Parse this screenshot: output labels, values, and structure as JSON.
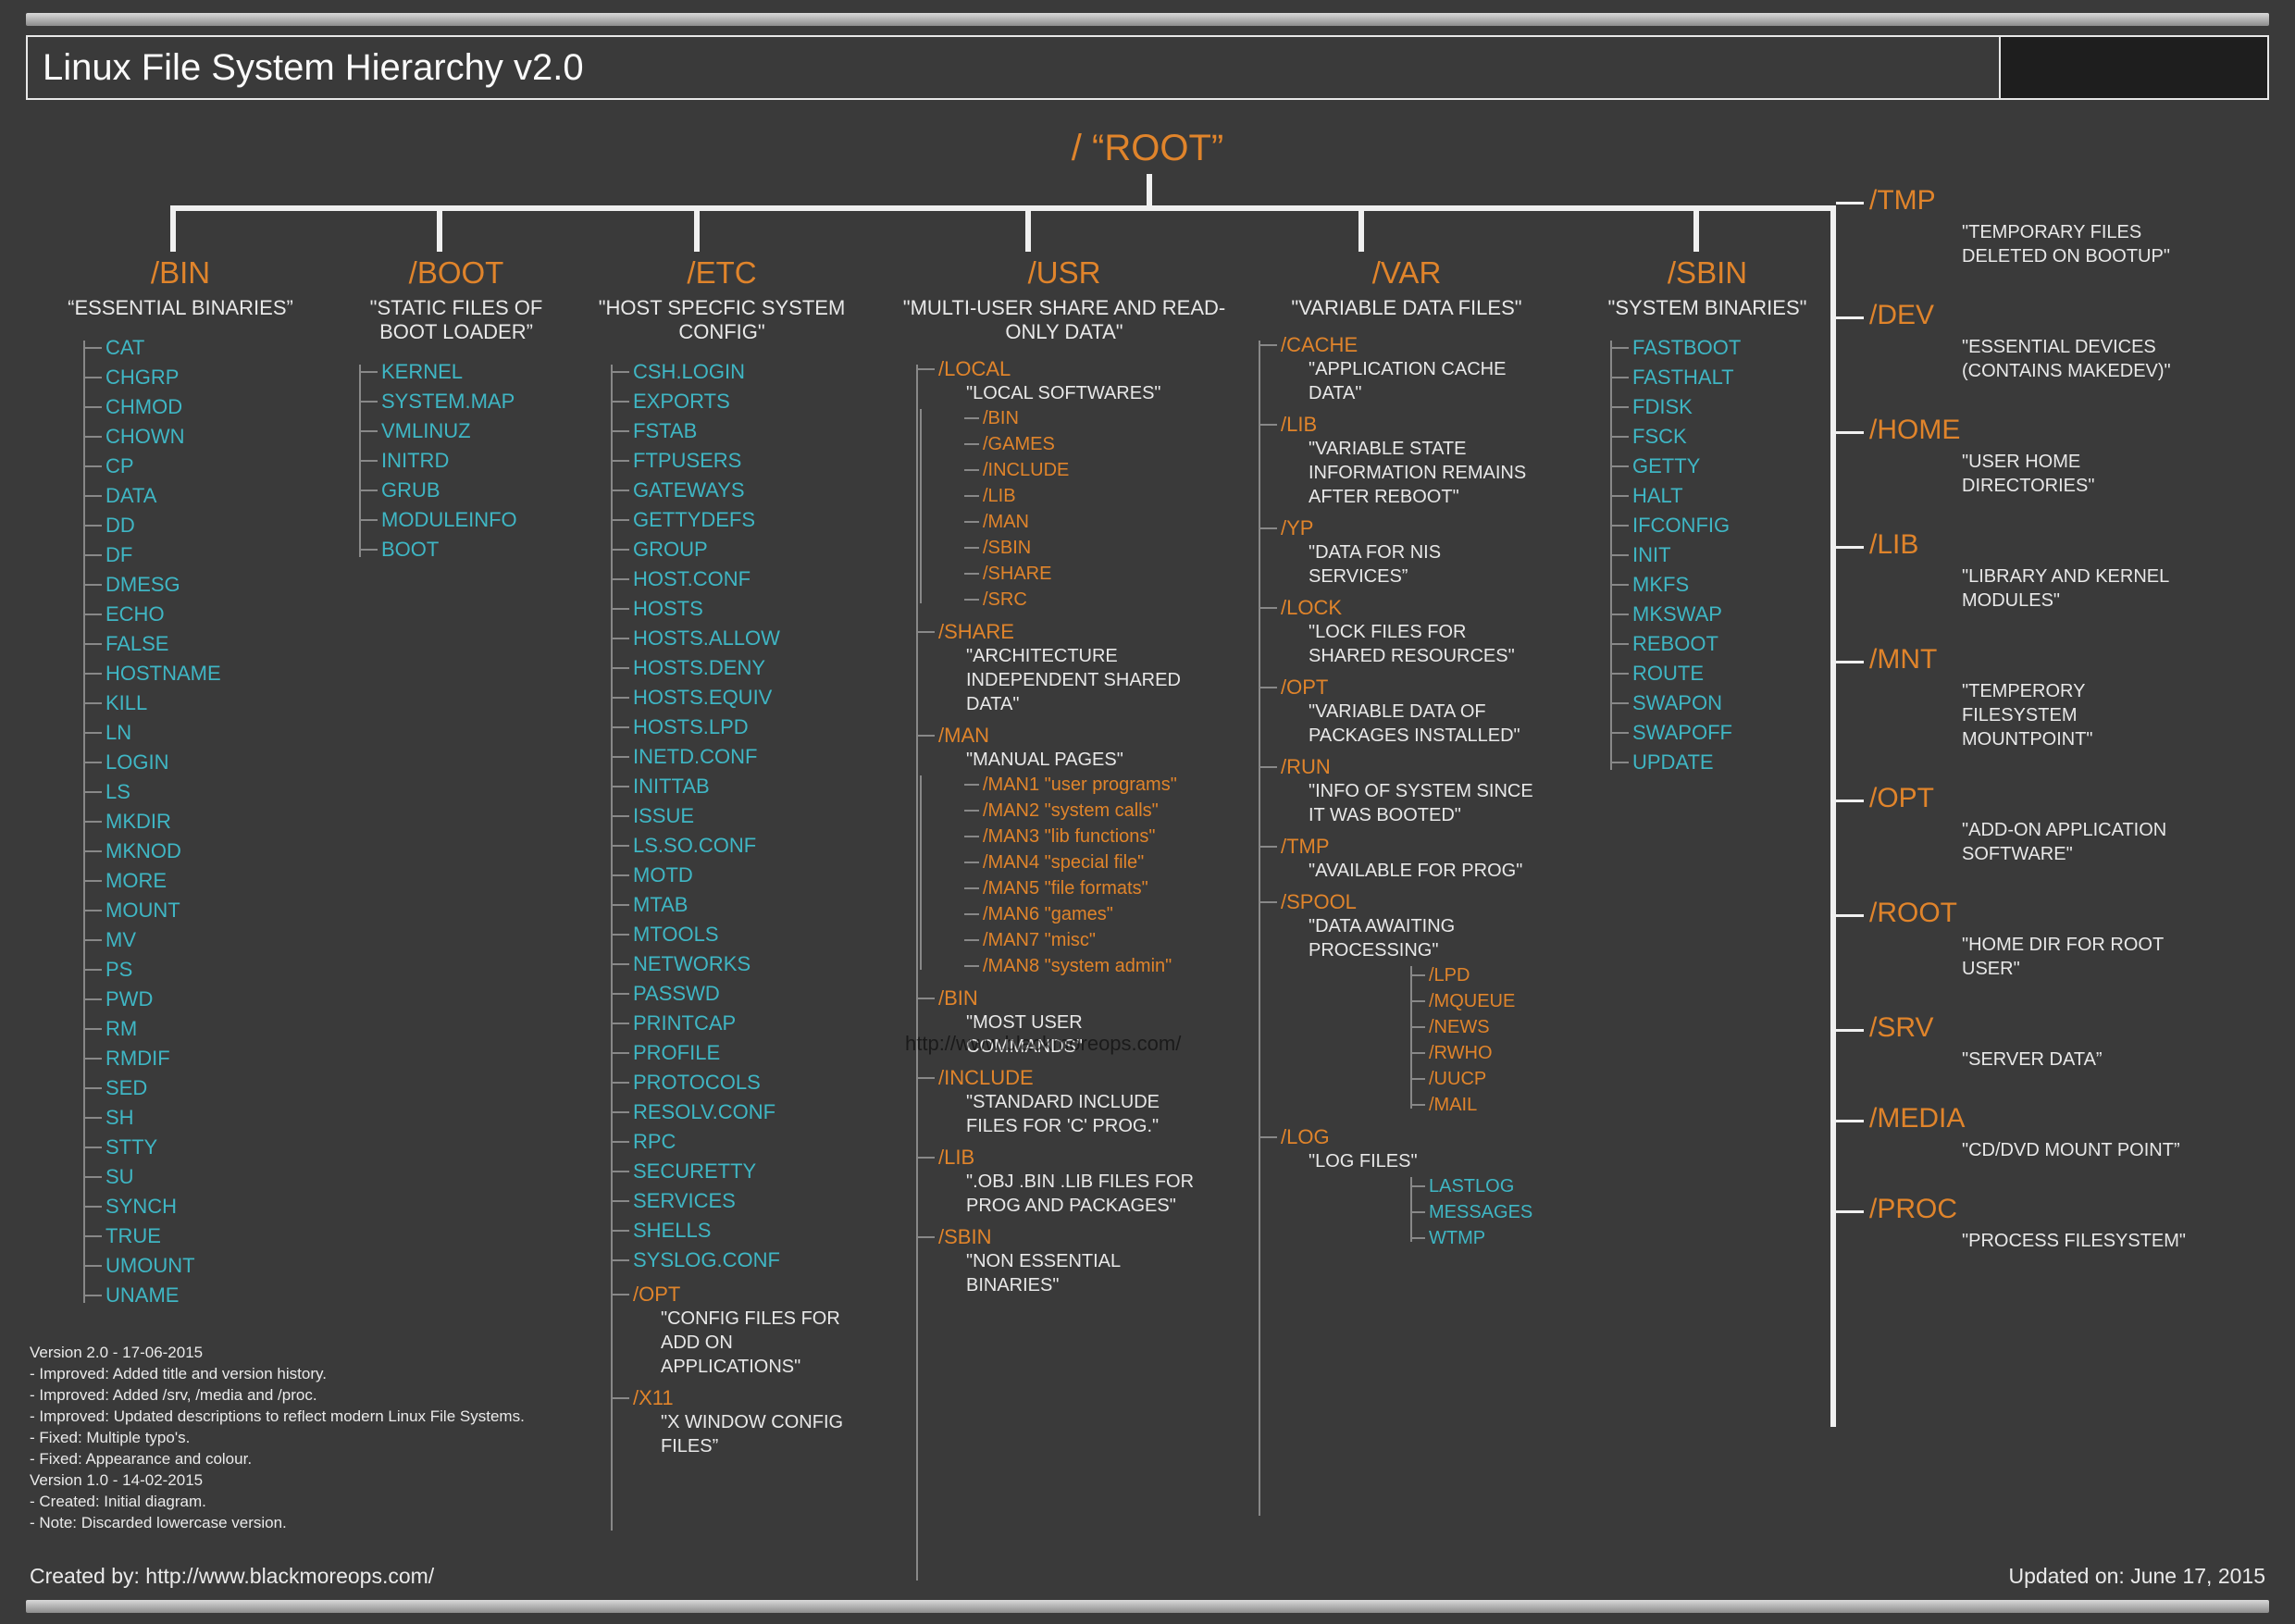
{
  "title": "Linux File System Hierarchy v2.0",
  "root_label": "/ “ROOT”",
  "watermark": "http://www.blackmoreops.com/",
  "footer": {
    "created_by": "Created by: http://www.blackmoreops.com/",
    "updated": "Updated on: June 17, 2015",
    "changelog": [
      "Version 2.0 - 17-06-2015",
      "- Improved: Added title and version history.",
      "- Improved: Added /srv, /media and /proc.",
      "- Improved: Updated descriptions to reflect modern Linux File Systems.",
      "- Fixed: Multiple typo's.",
      "- Fixed: Appearance and colour.",
      "Version 1.0 - 14-02-2015",
      "- Created: Initial diagram.",
      "- Note: Discarded lowercase version."
    ]
  },
  "cols": {
    "bin": {
      "head": "/BIN",
      "desc": "“ESSENTIAL BINARIES”",
      "items": [
        "CAT",
        "CHGRP",
        "CHMOD",
        "CHOWN",
        "CP",
        "DATA",
        "DD",
        "DF",
        "DMESG",
        "ECHO",
        "FALSE",
        "HOSTNAME",
        "KILL",
        "LN",
        "LOGIN",
        "LS",
        "MKDIR",
        "MKNOD",
        "MORE",
        "MOUNT",
        "MV",
        "PS",
        "PWD",
        "RM",
        "RMDIF",
        "SED",
        "SH",
        "STTY",
        "SU",
        "SYNCH",
        "TRUE",
        "UMOUNT",
        "UNAME"
      ]
    },
    "boot": {
      "head": "/BOOT",
      "desc": "\"STATIC FILES OF BOOT LOADER”",
      "items": [
        "KERNEL",
        "SYSTEM.MAP",
        "VMLINUZ",
        "INITRD",
        "GRUB",
        "MODULEINFO",
        "BOOT"
      ]
    },
    "etc": {
      "head": "/ETC",
      "desc": "\"HOST SPECFIC SYSTEM CONFIG\"",
      "items": [
        "CSH.LOGIN",
        "EXPORTS",
        "FSTAB",
        "FTPUSERS",
        "GATEWAYS",
        "GETTYDEFS",
        "GROUP",
        "HOST.CONF",
        "HOSTS",
        "HOSTS.ALLOW",
        "HOSTS.DENY",
        "HOSTS.EQUIV",
        "HOSTS.LPD",
        "INETD.CONF",
        "INITTAB",
        "ISSUE",
        "LS.SO.CONF",
        "MOTD",
        "MTAB",
        "MTOOLS",
        "NETWORKS",
        "PASSWD",
        "PRINTCAP",
        "PROFILE",
        "PROTOCOLS",
        "RESOLV.CONF",
        "RPC",
        "SECURETTY",
        "SERVICES",
        "SHELLS",
        "SYSLOG.CONF"
      ],
      "subs": [
        {
          "head": "/OPT",
          "desc": "\"CONFIG FILES FOR ADD ON APPLICATIONS\""
        },
        {
          "head": "/X11",
          "desc": "\"X WINDOW CONFIG FILES”"
        }
      ]
    },
    "usr": {
      "head": "/USR",
      "desc": "\"MULTI-USER SHARE AND READ-ONLY DATA\"",
      "subs": [
        {
          "head": "/LOCAL",
          "desc": "\"LOCAL SOFTWARES\"",
          "items": [
            "/BIN",
            "/GAMES",
            "/INCLUDE",
            "/LIB",
            "/MAN",
            "/SBIN",
            "/SHARE",
            "/SRC"
          ]
        },
        {
          "head": "/SHARE",
          "desc": "\"ARCHITECTURE INDEPENDENT SHARED DATA\""
        },
        {
          "head": "/MAN",
          "desc": "\"MANUAL PAGES\"",
          "items": [
            "/MAN1 \"user programs\"",
            "/MAN2 \"system calls\"",
            "/MAN3 \"lib functions\"",
            "/MAN4 \"special file\"",
            "/MAN5 \"file formats\"",
            "/MAN6 \"games\"",
            "/MAN7 \"misc\"",
            "/MAN8 \"system admin\""
          ]
        },
        {
          "head": "/BIN",
          "desc": "\"MOST USER COMMANDS\""
        },
        {
          "head": "/INCLUDE",
          "desc": "\"STANDARD INCLUDE FILES FOR 'C' PROG.\""
        },
        {
          "head": "/LIB",
          "desc": "\".OBJ .BIN .LIB FILES FOR PROG AND PACKAGES\""
        },
        {
          "head": "/SBIN",
          "desc": "\"NON ESSENTIAL BINARIES\""
        }
      ]
    },
    "var": {
      "head": "/VAR",
      "desc": "\"VARIABLE DATA FILES\"",
      "subs": [
        {
          "head": "/CACHE",
          "desc": "\"APPLICATION CACHE DATA\""
        },
        {
          "head": "/LIB",
          "desc": "\"VARIABLE STATE INFORMATION REMAINS AFTER REBOOT\""
        },
        {
          "head": "/YP",
          "desc": "\"DATA FOR NIS SERVICES”"
        },
        {
          "head": "/LOCK",
          "desc": "\"LOCK FILES FOR SHARED RESOURCES\""
        },
        {
          "head": "/OPT",
          "desc": "\"VARIABLE DATA OF PACKAGES INSTALLED\""
        },
        {
          "head": "/RUN",
          "desc": "\"INFO OF SYSTEM SINCE IT WAS BOOTED\""
        },
        {
          "head": "/TMP",
          "desc": "\"AVAILABLE FOR PROG\""
        },
        {
          "head": "/SPOOL",
          "desc": "\"DATA AWAITING PROCESSING\"",
          "items": [
            "/LPD",
            "/MQUEUE",
            "/NEWS",
            "/RWHO",
            "/UUCP",
            "/MAIL"
          ]
        },
        {
          "head": "/LOG",
          "desc": "\"LOG FILES\"",
          "items_blue": [
            "LASTLOG",
            "MESSAGES",
            "WTMP"
          ]
        }
      ]
    },
    "sbin": {
      "head": "/SBIN",
      "desc": "\"SYSTEM BINARIES\"",
      "items": [
        "FASTBOOT",
        "FASTHALT",
        "FDISK",
        "FSCK",
        "GETTY",
        "HALT",
        "IFCONFIG",
        "INIT",
        "MKFS",
        "MKSWAP",
        "REBOOT",
        "ROUTE",
        "SWAPON",
        "SWAPOFF",
        "UPDATE"
      ]
    }
  },
  "side": [
    {
      "head": "/TMP",
      "desc": "\"TEMPORARY FILES DELETED ON BOOTUP\""
    },
    {
      "head": "/DEV",
      "desc": "\"ESSENTIAL DEVICES (CONTAINS MAKEDEV)\""
    },
    {
      "head": "/HOME",
      "desc": "\"USER HOME DIRECTORIES\""
    },
    {
      "head": "/LIB",
      "desc": "\"LIBRARY AND KERNEL MODULES\""
    },
    {
      "head": "/MNT",
      "desc": "\"TEMPERORY FILESYSTEM MOUNTPOINT\""
    },
    {
      "head": "/OPT",
      "desc": "\"ADD-ON APPLICATION SOFTWARE\""
    },
    {
      "head": "/ROOT",
      "desc": "\"HOME DIR FOR ROOT USER\""
    },
    {
      "head": "/SRV",
      "desc": "\"SERVER DATA”"
    },
    {
      "head": "/MEDIA",
      "desc": "\"CD/DVD MOUNT POINT”"
    },
    {
      "head": "/PROC",
      "desc": "\"PROCESS FILESYSTEM\""
    }
  ]
}
